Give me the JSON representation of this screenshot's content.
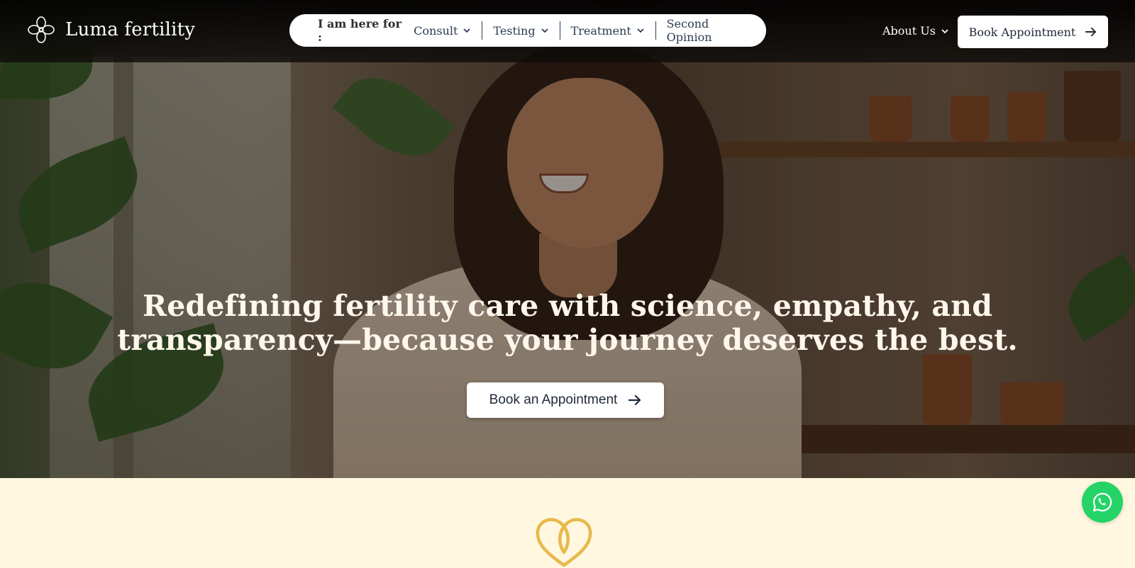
{
  "brand": {
    "name": "Luma fertility",
    "logo_icon": "flower-logo-icon"
  },
  "nav": {
    "lead_label": "I am here for :",
    "items": [
      {
        "label": "Consult",
        "has_dropdown": true
      },
      {
        "label": "Testing",
        "has_dropdown": true
      },
      {
        "label": "Treatment",
        "has_dropdown": true
      },
      {
        "label": "Second Opinion",
        "has_dropdown": false
      }
    ],
    "about_label": "About Us",
    "book_label": "Book Appointment"
  },
  "hero": {
    "headline_line1": "Redefining fertility care with science, empathy, and",
    "headline_line2": "transparency—because your journey deserves the best.",
    "cta_label": "Book an Appointment"
  },
  "colors": {
    "accent_cream": "#fff7e0",
    "whatsapp_green": "#25d366",
    "heart_gold": "#e8b94a"
  },
  "icons": {
    "whatsapp": "whatsapp-icon",
    "section_heart": "heart-loop-icon",
    "arrow": "arrow-right-icon"
  }
}
